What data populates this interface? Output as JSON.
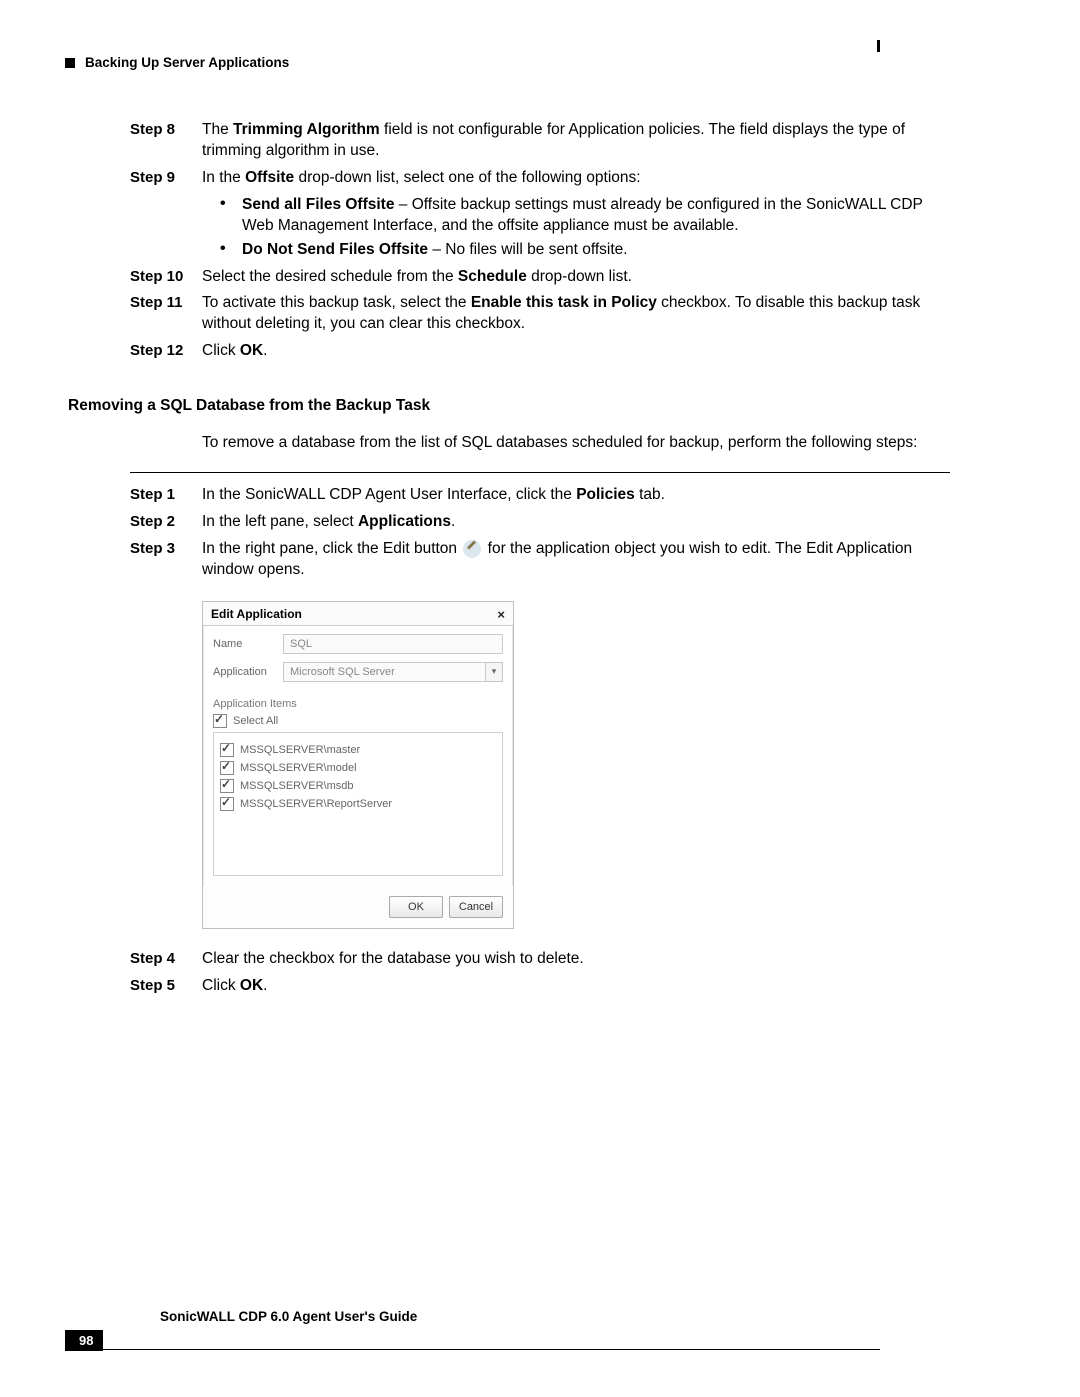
{
  "header": {
    "section_title": "Backing Up Server Applications"
  },
  "steps_a": [
    {
      "n": "Step 8",
      "html": "The <b>Trimming Algorithm</b> field is not configurable for Application policies. The field displays the type of trimming algorithm in use."
    },
    {
      "n": "Step 9",
      "html": "In the <b>Offsite</b> drop-down list, select one of the following options:"
    }
  ],
  "bullets": [
    {
      "html": "<b>Send all Files Offsite</b> – Offsite backup settings must already be configured in the SonicWALL CDP Web Management Interface, and the offsite appliance must be available."
    },
    {
      "html": "<b>Do Not Send Files Offsite</b> – No files will be sent offsite."
    }
  ],
  "steps_b": [
    {
      "n": "Step 10",
      "html": "Select the desired schedule from the <b>Schedule</b> drop-down list."
    },
    {
      "n": "Step 11",
      "html": "To activate this backup task, select the <b>Enable this task in Policy</b> checkbox. To disable this backup task without deleting it, you can clear this checkbox."
    },
    {
      "n": "Step 12",
      "html": "Click <b>OK</b>."
    }
  ],
  "heading": "Removing a SQL Database from the Backup Task",
  "intro": "To remove a database from the list of SQL databases scheduled for backup, perform the following steps:",
  "steps_c": [
    {
      "n": "Step 1",
      "html": "In the SonicWALL CDP Agent User Interface, click the <b>Policies</b> tab."
    },
    {
      "n": "Step 2",
      "html": "In the left pane, select <b>Applications</b>."
    },
    {
      "n": "Step 3",
      "html_before": "In the right pane, click the Edit button ",
      "html_after": " for the application object you wish to edit. The Edit Application window opens."
    }
  ],
  "dialog": {
    "title": "Edit Application",
    "close": "×",
    "name_label": "Name",
    "name_value": "SQL",
    "app_label": "Application",
    "app_value": "Microsoft SQL Server",
    "items_label": "Application Items",
    "select_all": "Select All",
    "items": [
      "MSSQLSERVER\\master",
      "MSSQLSERVER\\model",
      "MSSQLSERVER\\msdb",
      "MSSQLSERVER\\ReportServer"
    ],
    "ok": "OK",
    "cancel": "Cancel"
  },
  "steps_d": [
    {
      "n": "Step 4",
      "html": "Clear the checkbox for the database you wish to delete."
    },
    {
      "n": "Step 5",
      "html": "Click <b>OK</b>."
    }
  ],
  "footer": {
    "guide": "SonicWALL CDP 6.0 Agent User's Guide",
    "page": "98"
  }
}
